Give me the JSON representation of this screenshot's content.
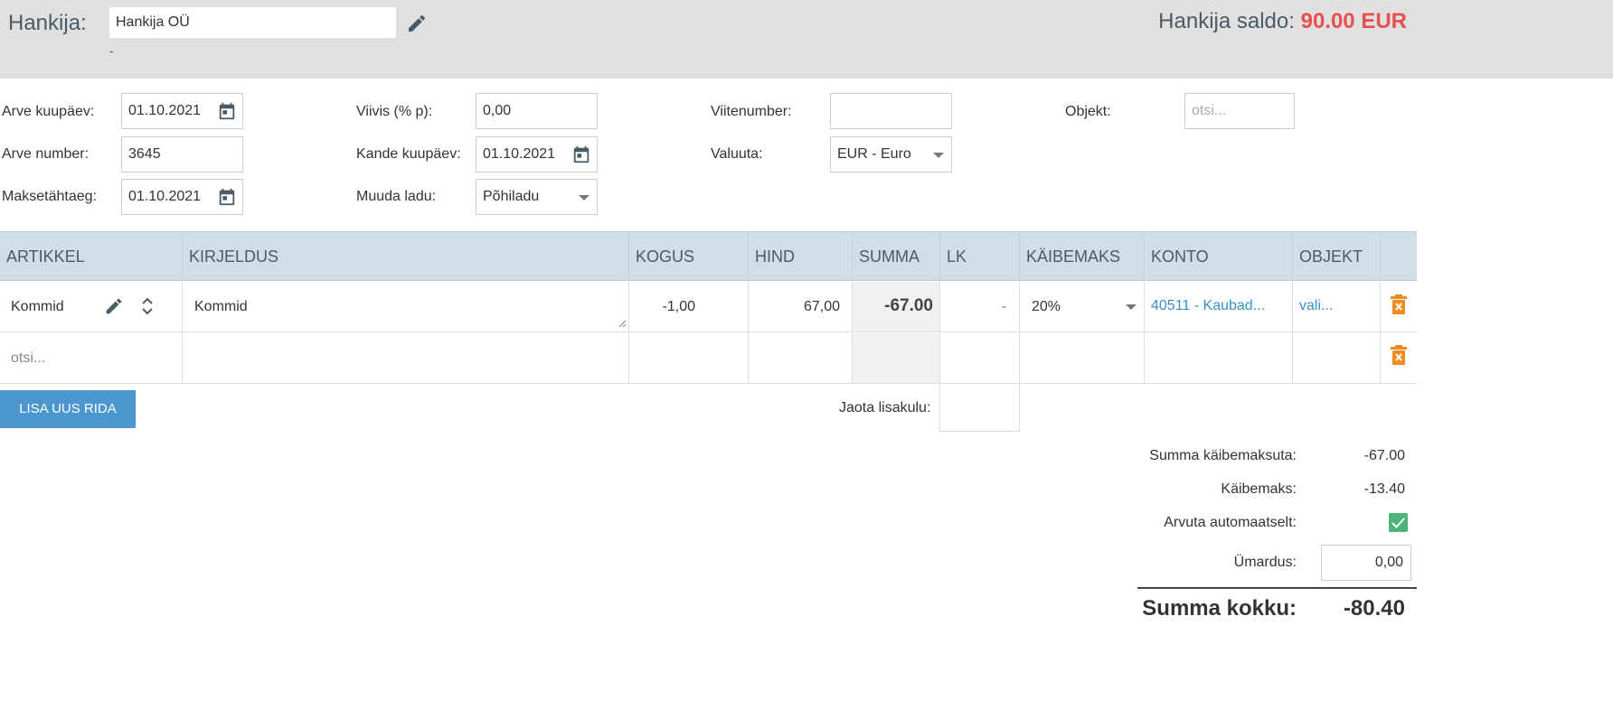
{
  "header": {
    "supplier_label": "Hankija:",
    "supplier_value": "Hankija OÜ",
    "supplier_sub": "-",
    "saldo_label": "Hankija saldo:",
    "saldo_value": "90.00 EUR",
    "saldo_color": "#e8504f"
  },
  "form": {
    "invoice_date_label": "Arve kuupäev:",
    "invoice_date": "01.10.2021",
    "invoice_number_label": "Arve number:",
    "invoice_number": "3645",
    "due_date_label": "Maksetähtaeg:",
    "due_date": "01.10.2021",
    "penalty_label": "Viivis (% p):",
    "penalty": "0,00",
    "entry_date_label": "Kande kuupäev:",
    "entry_date": "01.10.2021",
    "warehouse_label": "Muuda ladu:",
    "warehouse": "Põhiladu",
    "reference_label": "Viitenumber:",
    "reference": "",
    "currency_label": "Valuuta:",
    "currency": "EUR - Euro",
    "object_label": "Objekt:",
    "object_placeholder": "otsi..."
  },
  "table": {
    "columns": [
      "ARTIKKEL",
      "KIRJELDUS",
      "KOGUS",
      "HIND",
      "SUMMA",
      "LK",
      "KÄIBEMAKS",
      "KONTO",
      "OBJEKT"
    ],
    "rows": [
      {
        "artikkel": "Kommid",
        "kirjeldus": "Kommid",
        "kogus": "-1,00",
        "hind": "67,00",
        "summa": "-67.00",
        "lk": "-",
        "kaibemaks": "20%",
        "konto": "40511 - Kaubad...",
        "objekt": "vali..."
      }
    ],
    "new_row_placeholder": "otsi..."
  },
  "actions": {
    "add_row": "LISA UUS RIDA",
    "distribute_label": "Jaota lisakulu:"
  },
  "totals": {
    "subtotal_label": "Summa käibemaksuta:",
    "subtotal": "-67.00",
    "vat_label": "Käibemaks:",
    "vat": "-13.40",
    "auto_label": "Arvuta automaatselt:",
    "auto_checked": true,
    "rounding_label": "Ümardus:",
    "rounding": "0,00",
    "grand_label": "Summa kokku:",
    "grand_total": "-80.40"
  },
  "colors": {
    "accent": "#4c97cf",
    "delete": "#f08a24",
    "link": "#3a8fc8",
    "check": "#4cb477"
  }
}
